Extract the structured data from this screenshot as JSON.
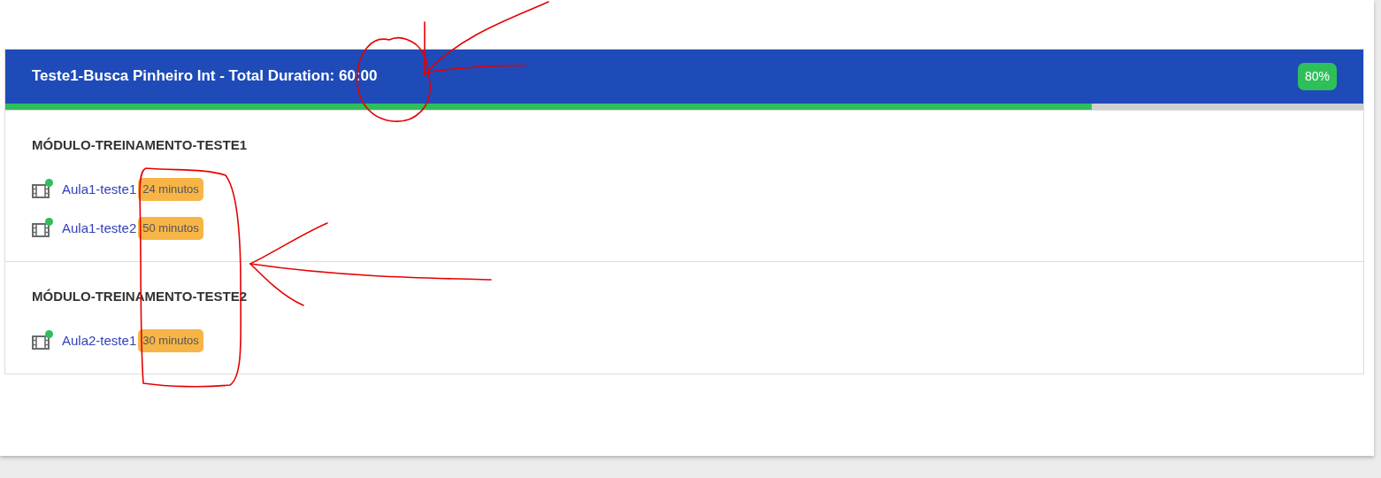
{
  "course": {
    "title": "Teste1-Busca Pinheiro Int - Total Duration: 60:00",
    "progress_label": "80%",
    "level": 0.8
  },
  "modules": [
    {
      "title": "MÓDULO-TREINAMENTO-TESTE1",
      "lessons": [
        {
          "title": "Aula1-teste1",
          "duration": "24 minutos",
          "completed": true
        },
        {
          "title": "Aula1-teste2",
          "duration": "50 minutos",
          "completed": true
        }
      ]
    },
    {
      "title": "MÓDULO-TREINAMENTO-TESTE2",
      "lessons": [
        {
          "title": "Aula2-teste1",
          "duration": "30 minutos",
          "completed": true
        }
      ]
    }
  ]
}
